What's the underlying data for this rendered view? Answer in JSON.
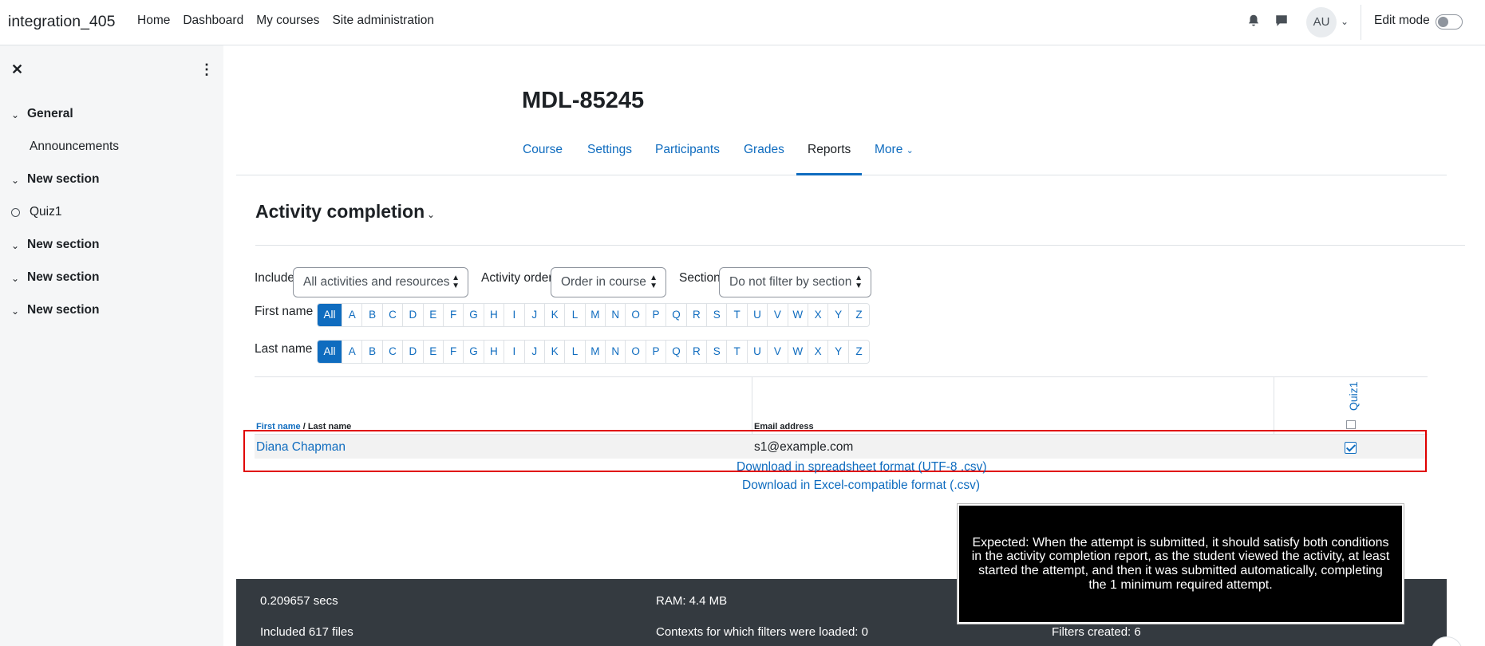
{
  "navbar": {
    "brand": "integration_405",
    "links": [
      "Home",
      "Dashboard",
      "My courses",
      "Site administration"
    ],
    "avatar_initials": "AU",
    "edit_mode_label": "Edit mode"
  },
  "drawer": {
    "close_glyph": "✕",
    "menu_glyph": "⋮",
    "course_index": [
      {
        "type": "section",
        "label": "General"
      },
      {
        "type": "activity",
        "label": "Announcements"
      },
      {
        "type": "section",
        "label": "New section"
      },
      {
        "type": "activity-circle",
        "label": "Quiz1"
      },
      {
        "type": "section",
        "label": "New section"
      },
      {
        "type": "section",
        "label": "New section"
      },
      {
        "type": "section",
        "label": "New section"
      }
    ]
  },
  "course": {
    "title": "MDL-85245",
    "tabs": [
      "Course",
      "Settings",
      "Participants",
      "Grades",
      "Reports",
      "More"
    ],
    "active_tab": "Reports"
  },
  "report": {
    "heading": "Activity completion",
    "filters": {
      "include_label": "Include",
      "include_value": "All activities and resources",
      "order_label": "Activity order",
      "order_value": "Order in course",
      "section_label": "Section",
      "section_value": "Do not filter by section"
    },
    "first_name_label": "First name",
    "last_name_label": "Last name",
    "initials": [
      "All",
      "A",
      "B",
      "C",
      "D",
      "E",
      "F",
      "G",
      "H",
      "I",
      "J",
      "K",
      "L",
      "M",
      "N",
      "O",
      "P",
      "Q",
      "R",
      "S",
      "T",
      "U",
      "V",
      "W",
      "X",
      "Y",
      "Z"
    ],
    "table": {
      "header_first": "First name",
      "header_sep": " / ",
      "header_last": "Last name",
      "header_email": "Email address",
      "header_activity": "Quiz1",
      "rows": [
        {
          "name": "Diana Chapman",
          "email": "s1@example.com",
          "completed": true
        }
      ]
    },
    "downloads": [
      "Download in spreadsheet format (UTF-8 .csv)",
      "Download in Excel-compatible format (.csv)"
    ]
  },
  "footer": {
    "time": "0.209657 secs",
    "ram": "RAM: 4.4 MB",
    "files": "Included 617 files",
    "contexts": "Contexts for which filters were loaded: 0",
    "filters_created": "Filters created: 6"
  },
  "note": {
    "text": "Expected: When the attempt is submitted, it should satisfy both conditions in the activity completion report, as the student viewed the activity, at least started the attempt, and then it was submitted automatically, completing the 1 minimum required attempt."
  },
  "colors": {
    "link": "#0f6cbf",
    "footer_bg": "#343a40",
    "highlight": "#e00000",
    "drawer_bg": "#f5f6f7"
  }
}
